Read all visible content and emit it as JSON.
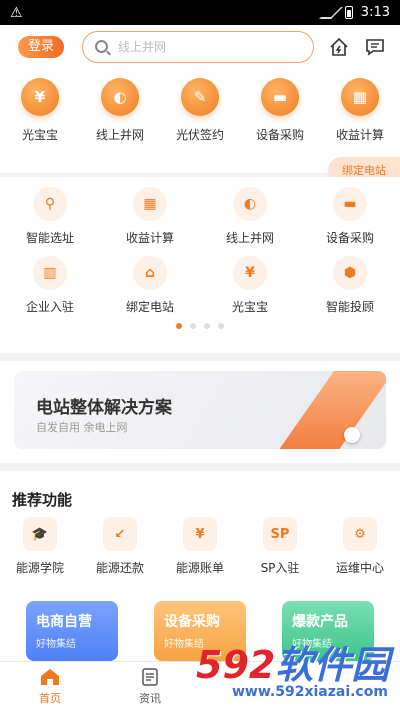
{
  "statusbar": {
    "time": "3:13",
    "warning_glyph": "⚠"
  },
  "header": {
    "login_label": "登录",
    "search_placeholder": "线上并网",
    "icons": [
      "lightning-house-icon",
      "message-icon"
    ]
  },
  "top_nav": [
    {
      "label": "光宝宝",
      "glyph": "¥",
      "icon": "money-bag-icon"
    },
    {
      "label": "线上并网",
      "glyph": "◐",
      "icon": "globe-icon"
    },
    {
      "label": "光伏签约",
      "glyph": "✎",
      "icon": "contract-icon"
    },
    {
      "label": "设备采购",
      "glyph": "▬",
      "icon": "wallet-icon"
    },
    {
      "label": "收益计算",
      "glyph": "▦",
      "icon": "calculator-icon"
    }
  ],
  "bind_station_tag": "绑定电站",
  "service_grid": {
    "rows": [
      [
        {
          "label": "智能选址",
          "glyph": "⚲",
          "icon": "location-pin-icon"
        },
        {
          "label": "收益计算",
          "glyph": "▦",
          "icon": "calculator-icon"
        },
        {
          "label": "线上并网",
          "glyph": "◐",
          "icon": "globe-icon"
        },
        {
          "label": "设备采购",
          "glyph": "▬",
          "icon": "wallet-icon"
        }
      ],
      [
        {
          "label": "企业入驻",
          "glyph": "▥",
          "icon": "building-icon"
        },
        {
          "label": "绑定电站",
          "glyph": "⌂",
          "icon": "home-lightning-icon"
        },
        {
          "label": "光宝宝",
          "glyph": "¥",
          "icon": "money-bag-icon"
        },
        {
          "label": "智能投顾",
          "glyph": "⬢",
          "icon": "advisor-icon"
        }
      ]
    ],
    "pages": 4,
    "active_page": 1
  },
  "banner": {
    "title": "电站整体解决方案",
    "subtitle": "自发自用  余电上网"
  },
  "recommend": {
    "title": "推荐功能",
    "items": [
      {
        "label": "能源学院",
        "glyph": "🎓",
        "icon": "graduation-cap-icon"
      },
      {
        "label": "能源还款",
        "glyph": "↙",
        "icon": "repayment-icon"
      },
      {
        "label": "能源账单",
        "glyph": "¥",
        "icon": "bill-icon"
      },
      {
        "label": "SP入驻",
        "glyph": "SP",
        "icon": "sp-icon"
      },
      {
        "label": "运维中心",
        "glyph": "⚙",
        "icon": "maintenance-icon"
      }
    ],
    "cards": [
      {
        "title": "电商自营",
        "subtitle": "好物集结"
      },
      {
        "title": "设备采购",
        "subtitle": "好物集结"
      },
      {
        "title": "爆款产品",
        "subtitle": "好物集结"
      }
    ]
  },
  "tabbar": [
    {
      "label": "首页",
      "icon": "home-icon",
      "active": true
    },
    {
      "label": "资讯",
      "icon": "news-icon",
      "active": false
    }
  ],
  "watermark": {
    "main": "软件园",
    "num": "592",
    "url": "www.592xiazai.com"
  },
  "colors": {
    "accent": "#f07b1e",
    "blue_card": "#4f80f5",
    "orange_card": "#f7a340",
    "green_card": "#3ec48a"
  }
}
